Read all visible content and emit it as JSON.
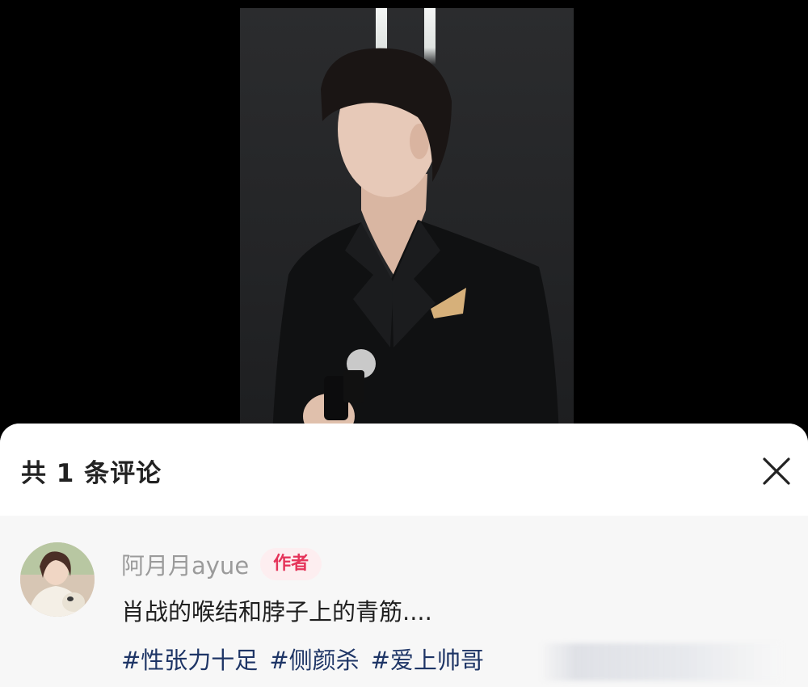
{
  "comments_panel": {
    "title": "共 1 条评论",
    "close_icon": "close-icon"
  },
  "comment": {
    "username": "阿月月ayue",
    "author_badge": "作者",
    "text": "肖战的喉结和脖子上的青筋....",
    "hashtags": [
      "#性张力十足",
      "#侧颜杀",
      "#爱上帅哥"
    ]
  },
  "colors": {
    "badge_text": "#e5345a",
    "badge_bg": "#fdeef0",
    "hashtag": "#1e3566",
    "username": "#9b9b9b"
  }
}
